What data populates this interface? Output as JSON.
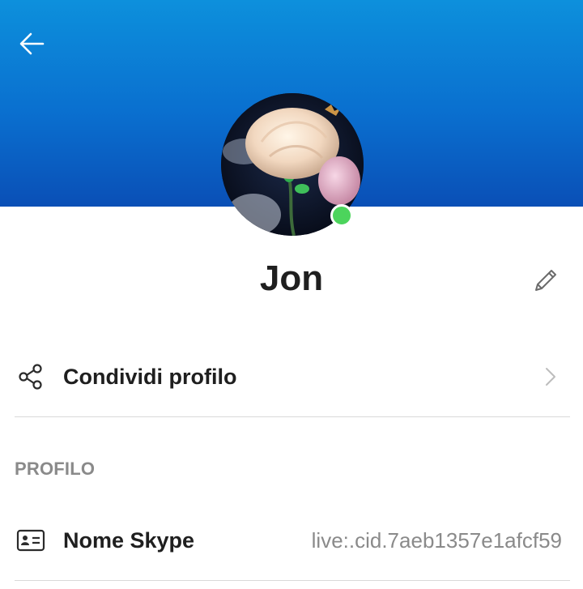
{
  "header": {
    "back_icon": "arrow-left-icon",
    "colors": {
      "gradient_top": "#0d90dc",
      "gradient_bottom": "#0a4fb6"
    }
  },
  "profile": {
    "name": "Jon",
    "avatar": "rose-flower-photo",
    "presence": "online",
    "presence_color": "#4cd45c",
    "edit_icon": "pencil-icon"
  },
  "share": {
    "label": "Condividi profilo",
    "icon": "share-icon",
    "chevron_icon": "chevron-right-icon"
  },
  "profile_section": {
    "title": "PROFILO",
    "items": [
      {
        "label": "Nome Skype",
        "value": "live:.cid.7aeb1357e1afcf59",
        "icon": "id-card-icon"
      }
    ]
  }
}
